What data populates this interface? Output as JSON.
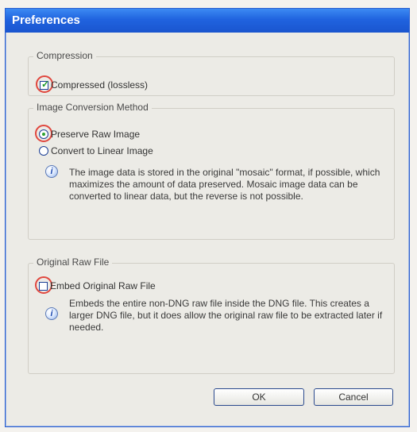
{
  "window": {
    "title": "Preferences"
  },
  "compression": {
    "group_label": "Compression",
    "checkbox_label": "Compressed (lossless)",
    "checked": true
  },
  "conversion": {
    "group_label": "Image Conversion Method",
    "options": [
      {
        "label": "Preserve Raw Image",
        "selected": true
      },
      {
        "label": "Convert to Linear Image",
        "selected": false
      }
    ],
    "info_lines": [
      "The image data is stored in the original \"mosaic\" format, if possible, which",
      "maximizes the amount of data preserved.  Mosaic image data can be",
      "converted to linear data, but the reverse is not possible."
    ]
  },
  "original_raw": {
    "group_label": "Original Raw File",
    "checkbox_label": "Embed Original Raw File",
    "checked": false,
    "info_lines": [
      "Embeds the entire non-DNG raw file inside the DNG file.  This creates a",
      "larger DNG file, but it does allow the original raw file to be extracted later if",
      "needed."
    ]
  },
  "buttons": {
    "ok": "OK",
    "cancel": "Cancel"
  }
}
